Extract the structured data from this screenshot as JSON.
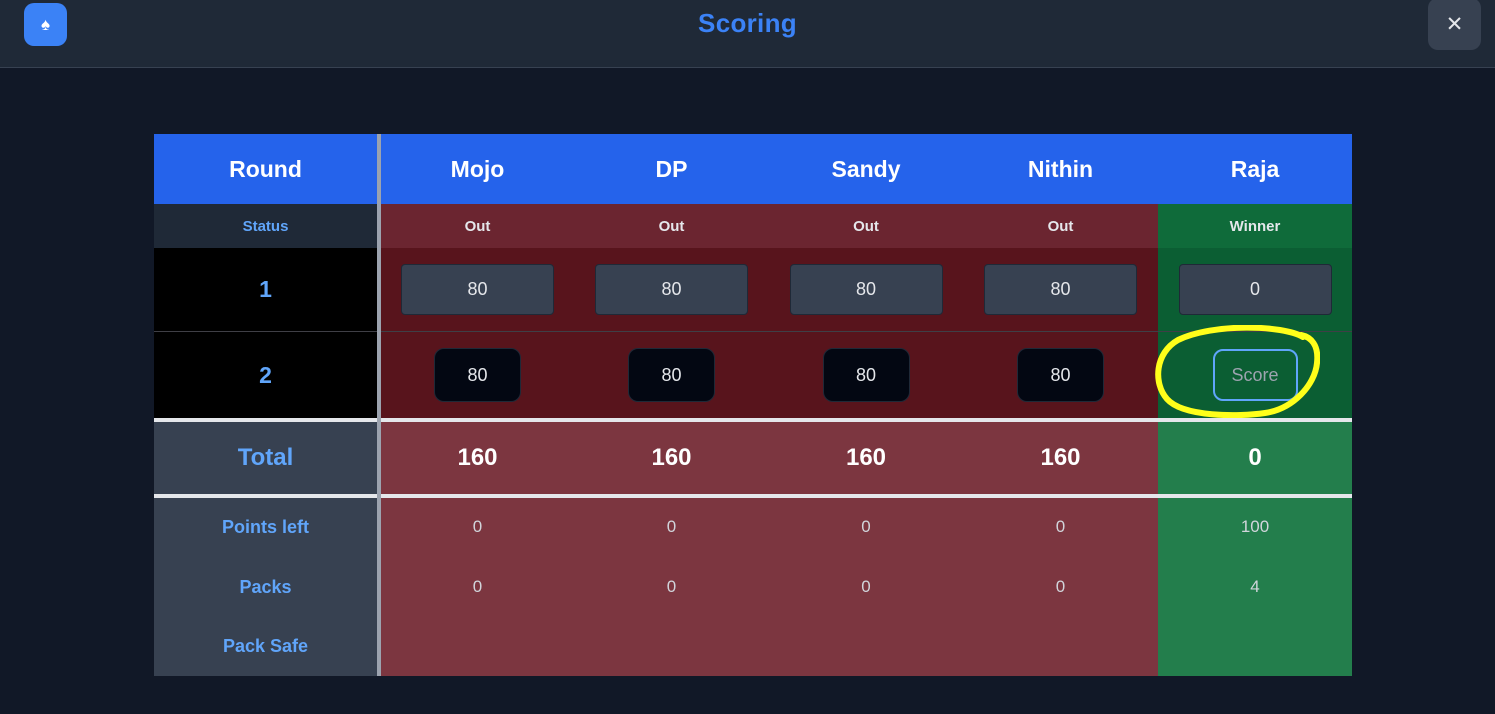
{
  "header": {
    "title": "Scoring",
    "logo_icon": "spade-icon",
    "close_icon": "close-icon"
  },
  "table": {
    "round_label": "Round",
    "status_label": "Status",
    "players": [
      {
        "name": "Mojo",
        "status": "Out",
        "round1": "80",
        "round2": "80",
        "total": "160",
        "points_left": "0",
        "packs": "0",
        "pack_safe": ""
      },
      {
        "name": "DP",
        "status": "Out",
        "round1": "80",
        "round2": "80",
        "total": "160",
        "points_left": "0",
        "packs": "0",
        "pack_safe": ""
      },
      {
        "name": "Sandy",
        "status": "Out",
        "round1": "80",
        "round2": "80",
        "total": "160",
        "points_left": "0",
        "packs": "0",
        "pack_safe": ""
      },
      {
        "name": "Nithin",
        "status": "Out",
        "round1": "80",
        "round2": "80",
        "total": "160",
        "points_left": "0",
        "packs": "0",
        "pack_safe": ""
      },
      {
        "name": "Raja",
        "status": "Winner",
        "round1": "0",
        "round2_button": "Score",
        "total": "0",
        "points_left": "100",
        "packs": "4",
        "pack_safe": ""
      }
    ],
    "rounds": [
      "1",
      "2"
    ],
    "total_label": "Total",
    "stat_labels": {
      "points_left": "Points left",
      "packs": "Packs",
      "pack_safe": "Pack Safe"
    }
  },
  "colors": {
    "header_blue": "#2563eb",
    "out_status_bg": "#6b2530",
    "out_round_bg": "#58141c",
    "out_total_bg": "#7c3640",
    "winner_status_bg": "#0f6b3a",
    "winner_round_bg": "#0b5e33",
    "winner_total_bg": "#237e4c",
    "round_label_bg": "#000000",
    "label_col_bg": "#374151",
    "highlight": "#ffff1a"
  }
}
